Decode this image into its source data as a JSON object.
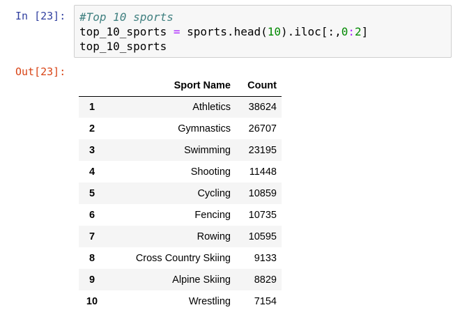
{
  "cell": {
    "in_prompt": "In [23]:",
    "out_prompt": "Out[23]:",
    "code": {
      "comment": "#Top 10 sports",
      "line2_var": "top_10_sports ",
      "line2_eq": "=",
      "line2_mid": " sports.head(",
      "line2_num1": "10",
      "line2_mid2": ").iloc[:,",
      "line2_num2": "0",
      "line2_colon": ":",
      "line2_num3": "2",
      "line2_end": "]",
      "line3": "top_10_sports"
    }
  },
  "table": {
    "columns": [
      "",
      "Sport Name",
      "Count"
    ],
    "rows": [
      {
        "index": "1",
        "sport": "Athletics",
        "count": "38624"
      },
      {
        "index": "2",
        "sport": "Gymnastics",
        "count": "26707"
      },
      {
        "index": "3",
        "sport": "Swimming",
        "count": "23195"
      },
      {
        "index": "4",
        "sport": "Shooting",
        "count": "11448"
      },
      {
        "index": "5",
        "sport": "Cycling",
        "count": "10859"
      },
      {
        "index": "6",
        "sport": "Fencing",
        "count": "10735"
      },
      {
        "index": "7",
        "sport": "Rowing",
        "count": "10595"
      },
      {
        "index": "8",
        "sport": "Cross Country Skiing",
        "count": "9133"
      },
      {
        "index": "9",
        "sport": "Alpine Skiing",
        "count": "8829"
      },
      {
        "index": "10",
        "sport": "Wrestling",
        "count": "7154"
      }
    ]
  }
}
